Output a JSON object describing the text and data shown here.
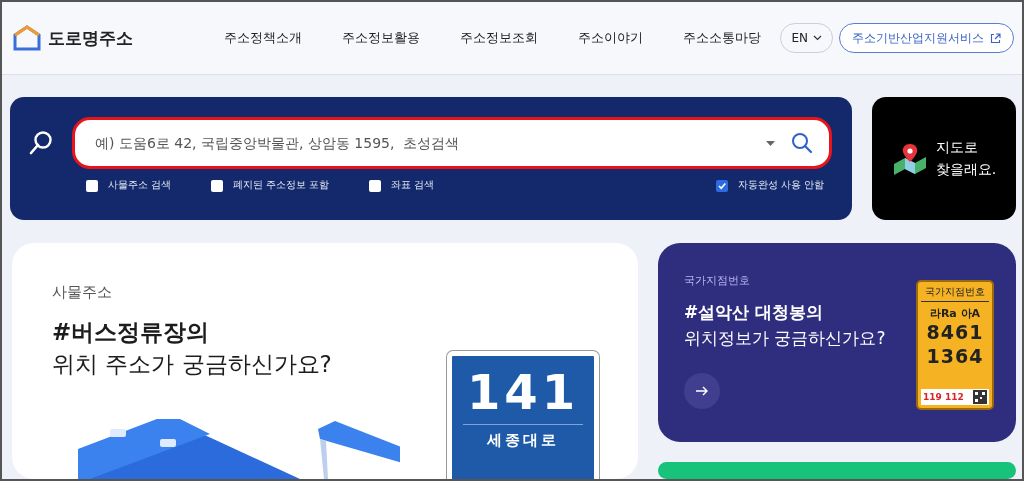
{
  "header": {
    "logo": "도로명주소",
    "nav": [
      {
        "label": "주소정책소개"
      },
      {
        "label": "주소정보활용"
      },
      {
        "label": "주소정보조회"
      },
      {
        "label": "주소이야기"
      },
      {
        "label": "주소소통마당"
      }
    ],
    "language": "EN",
    "service_link": "주소기반산업지원서비스"
  },
  "search": {
    "placeholder": "예) 도움6로 42, 국립중앙박물관, 상암동 1595,  초성검색",
    "options": [
      {
        "label": "사물주소 검색",
        "checked": false
      },
      {
        "label": "폐지된 주소정보 포함",
        "checked": false
      },
      {
        "label": "좌표 검색",
        "checked": false
      },
      {
        "label": "자동완성 사용 안함",
        "checked": true
      }
    ]
  },
  "map_button": {
    "label": "지도로\n찾을래요."
  },
  "object_card": {
    "category": "사물주소",
    "headline_1": "#버스정류장의",
    "headline_2": "위치 주소가 궁금하신가요?",
    "sign_number": "141",
    "sign_road": "세종대로"
  },
  "point_card": {
    "category": "국가지점번호",
    "headline_1": "#설악산 대청봉의",
    "headline_2": "위치정보가 궁금하신가요?",
    "plate_title": "국가지점번호",
    "plate_letters": "라Ra 아A",
    "plate_line_1": "8461",
    "plate_line_2": "1364",
    "plate_footer": "119 112"
  }
}
